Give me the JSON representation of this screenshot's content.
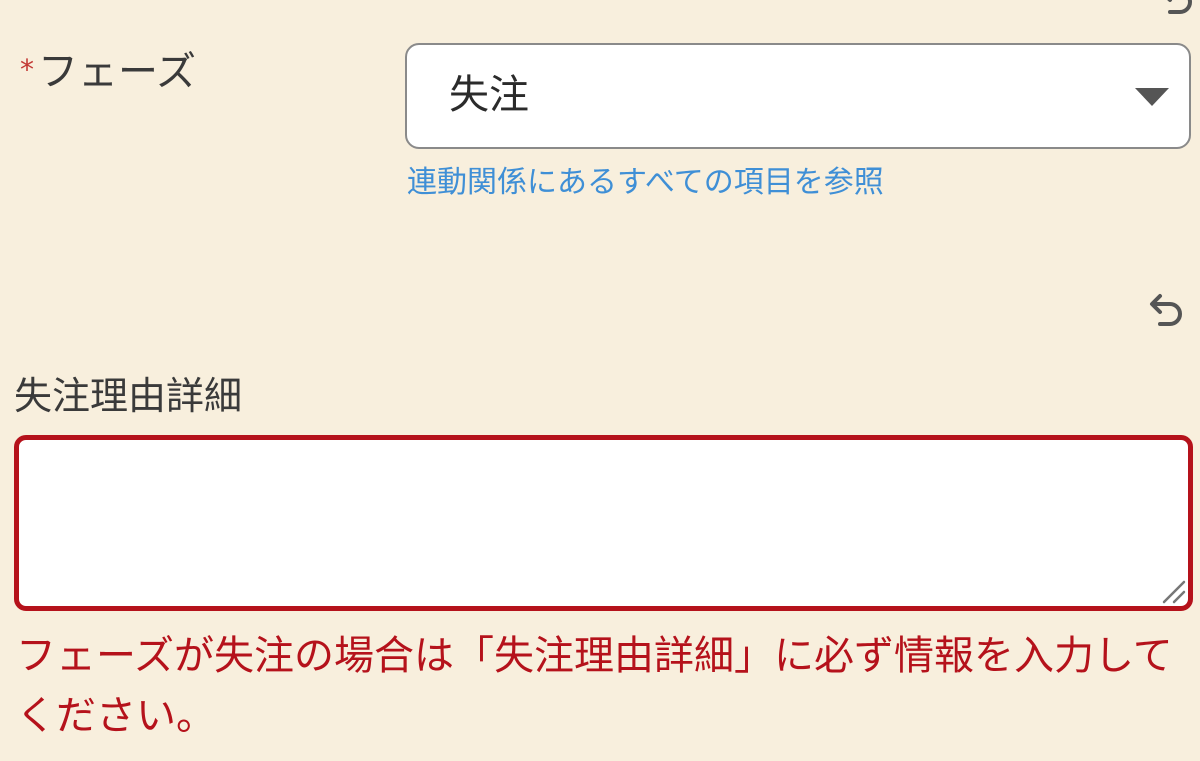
{
  "phase_field": {
    "required_mark": "*",
    "label": "フェーズ",
    "selected_value": "失注",
    "dependency_link": "連動関係にあるすべての項目を参照"
  },
  "reason_field": {
    "label": "失注理由詳細",
    "value": "",
    "error_message": "フェーズが失注の場合は「失注理由詳細」に必ず情報を入力してください。"
  },
  "icons": {
    "undo": "undo-icon",
    "select_caret": "caret-down-icon",
    "resize": "resize-grip-icon"
  },
  "colors": {
    "background": "#f8efdd",
    "required": "#c23934",
    "error": "#b5121b",
    "link": "#3f8fd6"
  }
}
